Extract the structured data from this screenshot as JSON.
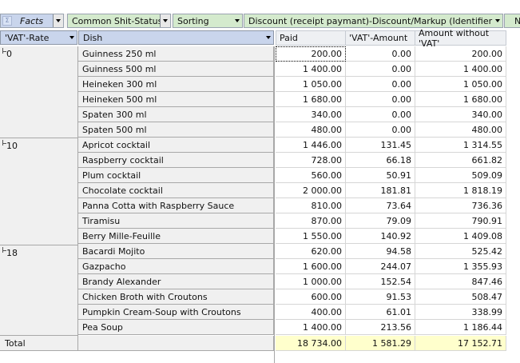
{
  "filter_bar": {
    "facts_label": "Facts",
    "filters": [
      "Common Shit-Status",
      "Sorting",
      "Discount (receipt paymant)-Discount/Markup (Identifier)",
      "Nor"
    ]
  },
  "row_headers": [
    "'VAT'-Rate",
    "Dish"
  ],
  "columns": [
    "Paid",
    "'VAT'-Amount",
    "Amount without 'VAT'"
  ],
  "groups": [
    {
      "vat": "0",
      "rows": [
        {
          "dish": "Guinness 250 ml",
          "paid": "200.00",
          "vat_amount": "0.00",
          "net": "200.00"
        },
        {
          "dish": "Guinness 500 ml",
          "paid": "1 400.00",
          "vat_amount": "0.00",
          "net": "1 400.00"
        },
        {
          "dish": "Heineken 300 ml",
          "paid": "1 050.00",
          "vat_amount": "0.00",
          "net": "1 050.00"
        },
        {
          "dish": "Heineken 500 ml",
          "paid": "1 680.00",
          "vat_amount": "0.00",
          "net": "1 680.00"
        },
        {
          "dish": "Spaten 300 ml",
          "paid": "340.00",
          "vat_amount": "0.00",
          "net": "340.00"
        },
        {
          "dish": "Spaten 500 ml",
          "paid": "480.00",
          "vat_amount": "0.00",
          "net": "480.00"
        }
      ]
    },
    {
      "vat": "10",
      "rows": [
        {
          "dish": "Apricot cocktail",
          "paid": "1 446.00",
          "vat_amount": "131.45",
          "net": "1 314.55"
        },
        {
          "dish": "Raspberry cocktail",
          "paid": "728.00",
          "vat_amount": "66.18",
          "net": "661.82"
        },
        {
          "dish": "Plum cocktail",
          "paid": "560.00",
          "vat_amount": "50.91",
          "net": "509.09"
        },
        {
          "dish": "Chocolate cocktail",
          "paid": "2 000.00",
          "vat_amount": "181.81",
          "net": "1 818.19"
        },
        {
          "dish": "Panna Cotta with Raspberry Sauce",
          "paid": "810.00",
          "vat_amount": "73.64",
          "net": "736.36"
        },
        {
          "dish": "Tiramisu",
          "paid": "870.00",
          "vat_amount": "79.09",
          "net": "790.91"
        },
        {
          "dish": "Berry Mille-Feuille",
          "paid": "1 550.00",
          "vat_amount": "140.92",
          "net": "1 409.08"
        }
      ]
    },
    {
      "vat": "18",
      "rows": [
        {
          "dish": "Bacardi Mojito",
          "paid": "620.00",
          "vat_amount": "94.58",
          "net": "525.42"
        },
        {
          "dish": "Gazpacho",
          "paid": "1 600.00",
          "vat_amount": "244.07",
          "net": "1 355.93"
        },
        {
          "dish": "Brandy Alexander",
          "paid": "1 000.00",
          "vat_amount": "152.54",
          "net": "847.46"
        },
        {
          "dish": "Chicken Broth with Croutons",
          "paid": "600.00",
          "vat_amount": "91.53",
          "net": "508.47"
        },
        {
          "dish": "Pumpkin Cream-Soup with Croutons",
          "paid": "400.00",
          "vat_amount": "61.01",
          "net": "338.99"
        },
        {
          "dish": "Pea Soup",
          "paid": "1 400.00",
          "vat_amount": "213.56",
          "net": "1 186.44"
        }
      ]
    }
  ],
  "total": {
    "label": "Total",
    "paid": "18 734.00",
    "vat_amount": "1 581.29",
    "net": "17 152.71"
  }
}
